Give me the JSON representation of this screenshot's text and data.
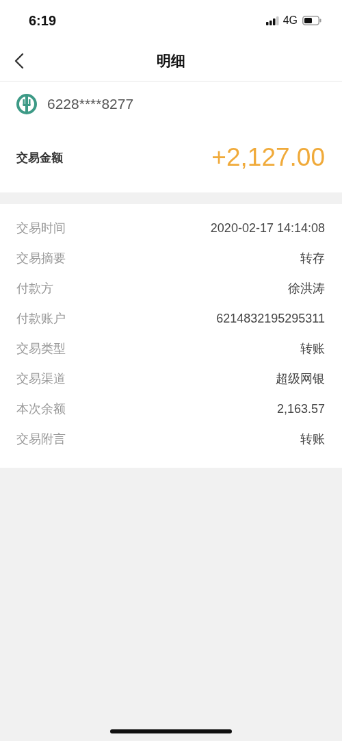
{
  "status_bar": {
    "time": "6:19",
    "network": "4G"
  },
  "nav": {
    "title": "明细"
  },
  "account": {
    "card_number": "6228****8277"
  },
  "amount": {
    "label": "交易金额",
    "value": "+2,127.00"
  },
  "details": [
    {
      "label": "交易时间",
      "value": "2020-02-17 14:14:08"
    },
    {
      "label": "交易摘要",
      "value": "转存"
    },
    {
      "label": "付款方",
      "value": "徐洪涛"
    },
    {
      "label": "付款账户",
      "value": "6214832195295311"
    },
    {
      "label": "交易类型",
      "value": "转账"
    },
    {
      "label": "交易渠道",
      "value": "超级网银"
    },
    {
      "label": "本次余额",
      "value": "2,163.57"
    },
    {
      "label": "交易附言",
      "value": "转账"
    }
  ]
}
